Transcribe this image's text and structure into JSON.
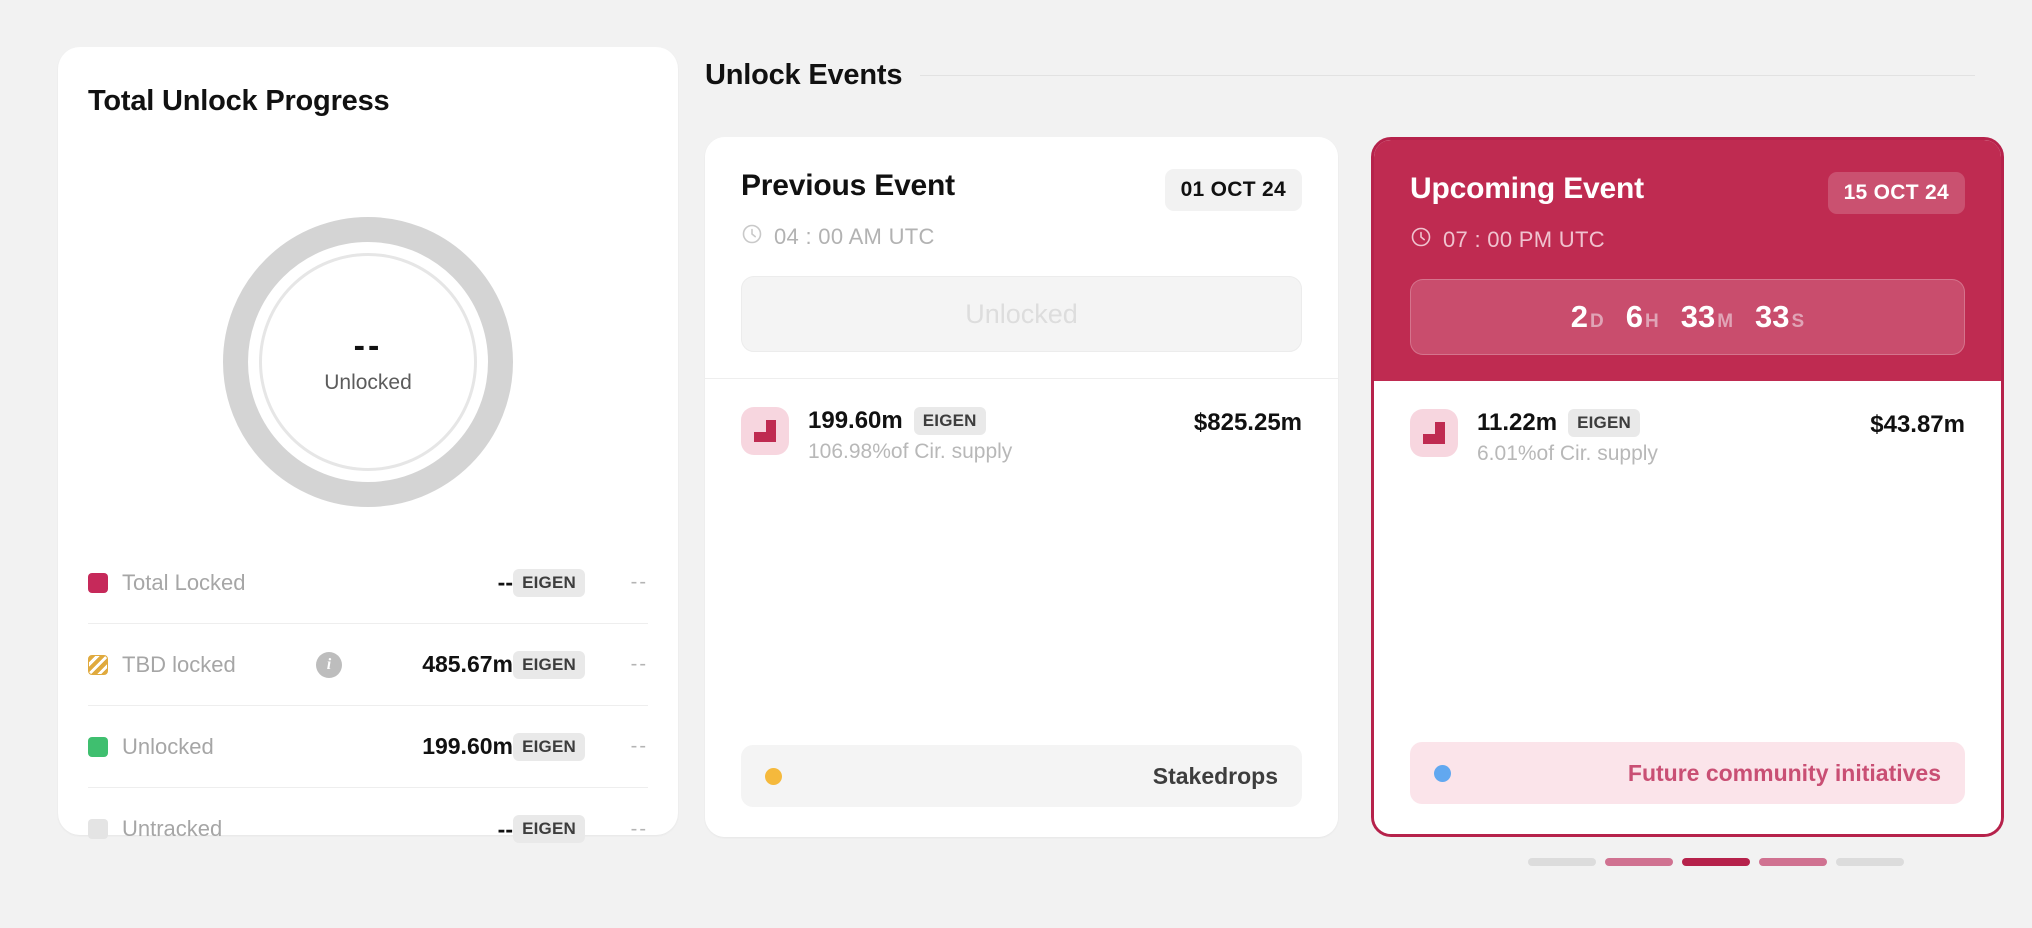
{
  "progress_card": {
    "title": "Total Unlock Progress",
    "donut": {
      "value": "--",
      "label": "Unlocked"
    },
    "legend": [
      {
        "name": "Total Locked",
        "swatch": "solid",
        "color": "#c6295a",
        "amount": "--",
        "ticker": "EIGEN",
        "percent": "--",
        "has_info": false
      },
      {
        "name": "TBD locked",
        "swatch": "striped",
        "color": "#e0aa3e",
        "amount": "485.67m",
        "ticker": "EIGEN",
        "percent": "--",
        "has_info": true,
        "info_glyph": "i"
      },
      {
        "name": "Unlocked",
        "swatch": "solid",
        "color": "#3fbf6f",
        "amount": "199.60m",
        "ticker": "EIGEN",
        "percent": "--",
        "has_info": false
      },
      {
        "name": "Untracked",
        "swatch": "solid",
        "color": "#e4e4e4",
        "amount": "--",
        "ticker": "EIGEN",
        "percent": "--",
        "has_info": false
      }
    ]
  },
  "events": {
    "title": "Unlock Events",
    "previous": {
      "name": "Previous Event",
      "date_badge": "01 OCT 24",
      "time": "04 : 00 AM UTC",
      "status": "Unlocked",
      "token": {
        "amount": "199.60m",
        "ticker": "EIGEN",
        "supply_note": "106.98%of Cir. supply",
        "usd": "$825.25m"
      },
      "tag": {
        "label": "Stakedrops",
        "dot_color": "#f5b93c"
      }
    },
    "upcoming": {
      "name": "Upcoming Event",
      "date_badge": "15 OCT 24",
      "time": "07 : 00 PM UTC",
      "countdown": [
        {
          "num": "2",
          "suffix": "D"
        },
        {
          "num": "6",
          "suffix": "H"
        },
        {
          "num": "33",
          "suffix": "M"
        },
        {
          "num": "33",
          "suffix": "S"
        }
      ],
      "token": {
        "amount": "11.22m",
        "ticker": "EIGEN",
        "supply_note": "6.01%of Cir. supply",
        "usd": "$43.87m"
      },
      "tag": {
        "label": "Future community initiatives",
        "dot_color": "#62a8f0"
      }
    }
  },
  "pagination": {
    "bars": [
      {
        "color": "#dcdcdc"
      },
      {
        "color": "#d07291"
      },
      {
        "color": "#b6224b"
      },
      {
        "color": "#d07291"
      },
      {
        "color": "#dcdcdc"
      }
    ]
  },
  "theme": {
    "accent": "#bf2b51",
    "accent_dark": "#b6224b",
    "background": "#f2f2f2"
  }
}
